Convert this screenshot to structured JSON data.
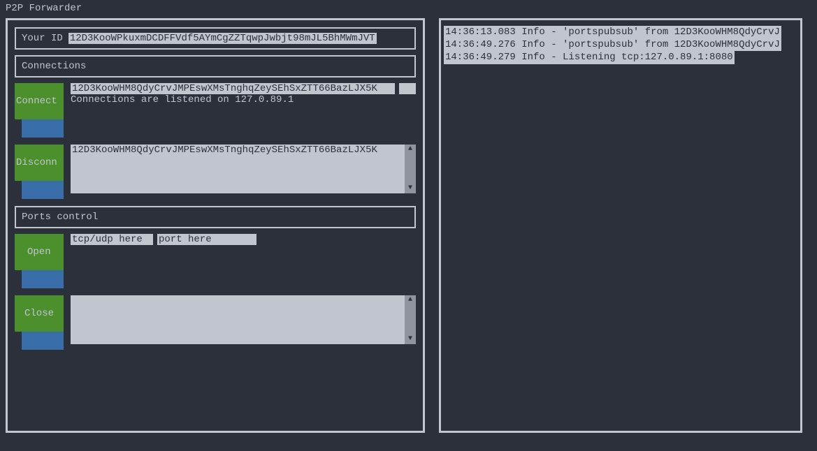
{
  "app_title": "P2P Forwarder",
  "your_id": {
    "label": "Your ID",
    "value": "12D3KooWPkuxmDCDFFVdf5AYmCgZZTqwpJwbjt98mJL5BhMWmJVT"
  },
  "connections": {
    "header": "Connections",
    "connect_btn": "Connect",
    "disconnect_btn": "Disconn",
    "input_value": "12D3KooWHM8QdyCrvJMPEswXMsTnghqZeySEhSxZTT66BazLJX5K",
    "listen_info": "Connections are listened on 127.0.89.1",
    "list_items": [
      "12D3KooWHM8QdyCrvJMPEswXMsTnghqZeySEhSxZTT66BazLJX5K"
    ]
  },
  "ports": {
    "header": "Ports control",
    "open_btn": "Open",
    "close_btn": "Close",
    "proto_placeholder": "tcp/udp here",
    "port_placeholder": "port here",
    "list_items": []
  },
  "log": [
    "14:36:13.083 Info - 'portspubsub' from 12D3KooWHM8QdyCrvJ",
    "14:36:49.276 Info - 'portspubsub' from 12D3KooWHM8QdyCrvJ",
    "14:36:49.279 Info - Listening tcp:127.0.89.1:8080"
  ]
}
